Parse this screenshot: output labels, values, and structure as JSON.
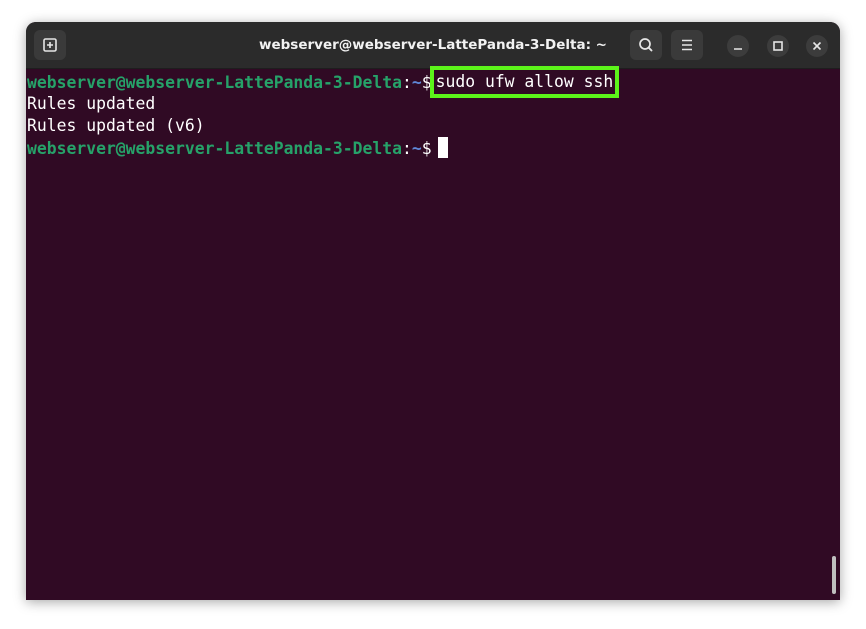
{
  "window": {
    "title": "webserver@webserver-LattePanda-3-Delta: ~"
  },
  "icons": {
    "new_tab": "new-tab-icon",
    "search": "search-icon",
    "menu": "hamburger-menu-icon",
    "minimize": "minimize-icon",
    "maximize": "maximize-icon",
    "close": "close-icon"
  },
  "terminal": {
    "prompt_user": "webserver@webserver-LattePanda-3-Delta",
    "prompt_colon": ":",
    "prompt_path": "~",
    "prompt_symbol": "$",
    "command": "sudo ufw allow ssh",
    "output": [
      "Rules updated",
      "Rules updated (v6)"
    ]
  },
  "colors": {
    "terminal_bg": "#300a24",
    "prompt_user": "#26a269",
    "prompt_path": "#5f87d7",
    "highlight_box": "#5cf41a",
    "titlebar_bg": "#2b2b2b"
  }
}
